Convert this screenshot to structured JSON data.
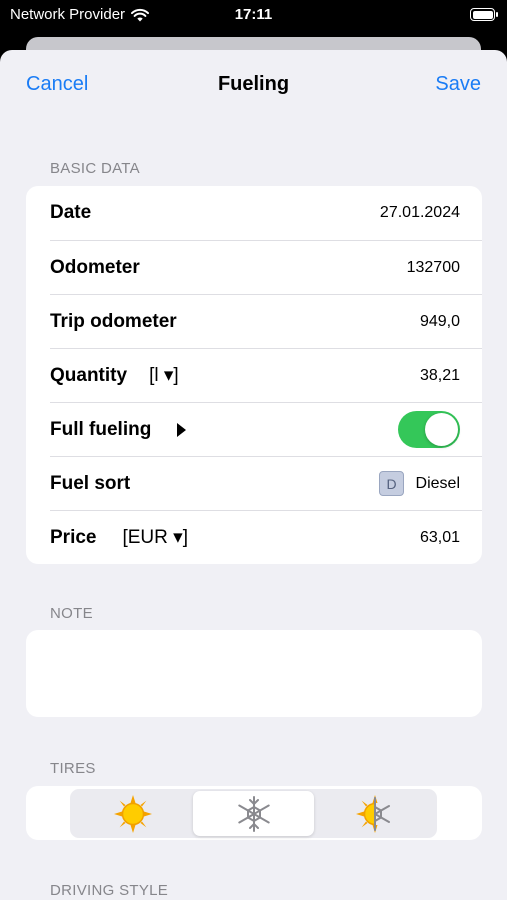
{
  "status_bar": {
    "carrier": "Network Provider",
    "time": "17:11",
    "battery_level": 1.0
  },
  "nav": {
    "cancel_label": "Cancel",
    "title": "Fueling",
    "save_label": "Save"
  },
  "basic_data": {
    "header": "BASIC DATA",
    "rows": [
      {
        "label": "Date",
        "value": "27.01.2024"
      },
      {
        "label": "Odometer",
        "value": "132700"
      },
      {
        "label": "Trip odometer",
        "value": "949,0"
      },
      {
        "label": "Quantity",
        "unit": "[l ▾]",
        "value": "38,21"
      },
      {
        "label": "Full fueling",
        "toggle_on": true
      },
      {
        "label": "Fuel sort",
        "badge": "D",
        "value": "Diesel"
      },
      {
        "label": "Price",
        "unit": "[EUR ▾]",
        "value": "63,01"
      }
    ]
  },
  "note": {
    "header": "NOTE",
    "value": ""
  },
  "tires": {
    "header": "TIRES",
    "options": [
      "summer-sun-icon",
      "winter-snowflake-icon",
      "all-season-icon"
    ],
    "selected_index": 1
  },
  "driving_style": {
    "header": "DRIVING STYLE"
  },
  "colors": {
    "accent": "#1a7cf5",
    "toggle_on": "#34c759",
    "background": "#f0f0f5"
  }
}
